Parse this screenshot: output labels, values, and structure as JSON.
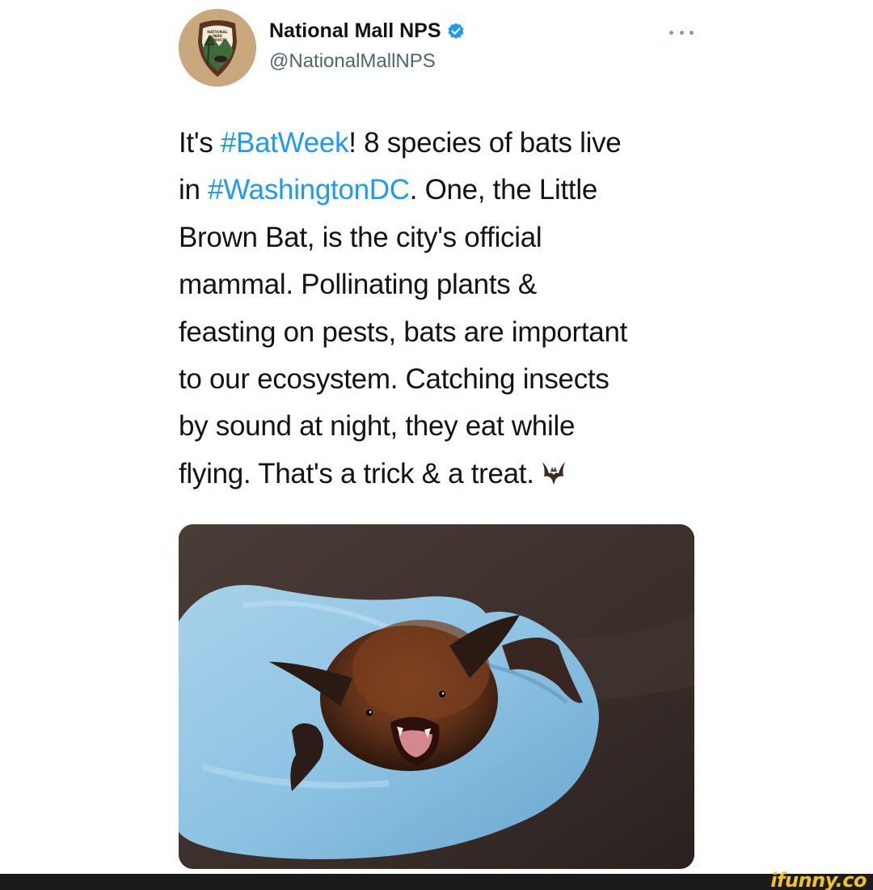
{
  "tweet": {
    "author": {
      "name": "National Mall NPS",
      "handle": "@NationalMallNPS",
      "avatar_icon": "nps-arrowhead-logo-icon",
      "avatar_logo_text": [
        "NATIONAL",
        "PARK",
        "SERVICE"
      ],
      "verified_icon": "verified-badge-icon"
    },
    "more_icon": "more-options-icon",
    "text_lines": [
      [
        {
          "t": "It's ",
          "tag": false
        },
        {
          "t": "#BatWeek",
          "tag": true
        },
        {
          "t": "! 8 species of bats live",
          "tag": false
        }
      ],
      [
        {
          "t": "in ",
          "tag": false
        },
        {
          "t": "#WashingtonDC",
          "tag": true
        },
        {
          "t": ". One, the Little",
          "tag": false
        }
      ],
      [
        {
          "t": "Brown Bat, is the city's official",
          "tag": false
        }
      ],
      [
        {
          "t": "mammal. Pollinating plants &",
          "tag": false
        }
      ],
      [
        {
          "t": "feasting on pests, bats are important",
          "tag": false
        }
      ],
      [
        {
          "t": "to our ecosystem. Catching insects",
          "tag": false
        }
      ],
      [
        {
          "t": "by sound at night, they eat while",
          "tag": false
        }
      ],
      [
        {
          "t": "flying. That's a trick & a treat.",
          "tag": false
        }
      ]
    ],
    "trailing_emoji": "bat-emoji-icon",
    "media_icon": "bat-in-gloved-hand-photo"
  },
  "colors": {
    "text": "#0f1419",
    "secondary": "#536471",
    "link": "#1d9bf0",
    "verified": "#1d9bf0",
    "watermark": "#f4c21c"
  },
  "watermark": {
    "text": "ifunny.co"
  }
}
